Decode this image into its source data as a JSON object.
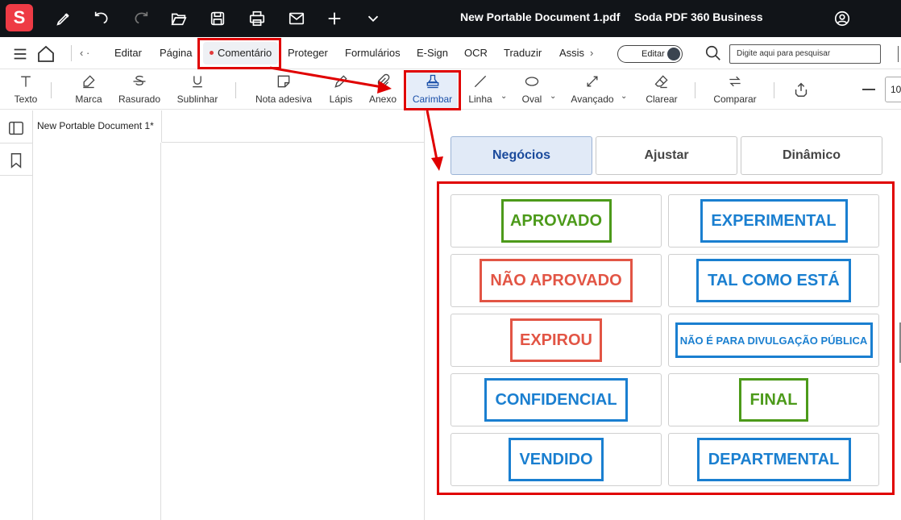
{
  "app": {
    "logo_letter": "S",
    "document_title": "New Portable Document 1.pdf",
    "app_title": "Soda PDF 360 Business"
  },
  "menu": {
    "back_label": "‹ ·",
    "items": [
      "Editar",
      "Página",
      "Comentário",
      "Proteger",
      "Formulários",
      "E-Sign",
      "OCR",
      "Traduzir",
      "Assis"
    ],
    "active": "Comentário",
    "more_label": "›",
    "edit_toggle_label": "Editar",
    "search_placeholder": "Digite aqui para pesquisar"
  },
  "toolbar": {
    "tools": [
      "Texto",
      "Marca",
      "Rasurado",
      "Sublinhar",
      "Nota adesiva",
      "Lápis",
      "Anexo",
      "Carimbar",
      "Linha",
      "Oval",
      "Avançado",
      "Clarear",
      "Comparar"
    ],
    "active": "Carimbar",
    "zoom_partial": "10"
  },
  "document": {
    "tab_label": "New Portable Document 1*"
  },
  "stamp_panel": {
    "tabs": [
      "Negócios",
      "Ajustar",
      "Dinâmico"
    ],
    "selected_tab": "Negócios",
    "stamps": [
      {
        "label": "APROVADO",
        "color": "#4c9a1a"
      },
      {
        "label": "EXPERIMENTAL",
        "color": "#1a7fd0"
      },
      {
        "label": "NÃO APROVADO",
        "color": "#e25545"
      },
      {
        "label": "TAL COMO ESTÁ",
        "color": "#1a7fd0"
      },
      {
        "label": "EXPIROU",
        "color": "#e25545"
      },
      {
        "label": "NÃO É PARA DIVULGAÇÃO PÚBLICA",
        "color": "#1a7fd0"
      },
      {
        "label": "CONFIDENCIAL",
        "color": "#1a7fd0"
      },
      {
        "label": "FINAL",
        "color": "#4c9a1a"
      },
      {
        "label": "VENDIDO",
        "color": "#1a7fd0"
      },
      {
        "label": "DEPARTMENTAL",
        "color": "#1a7fd0"
      }
    ]
  },
  "colors": {
    "titlebar_bg": "#111418",
    "logo_red": "#ee3b45",
    "annotation_red": "#e00000",
    "accent_blue": "#1a4fa8"
  },
  "icons": [
    "pen-icon",
    "undo-icon",
    "redo-icon",
    "folder-open-icon",
    "save-icon",
    "print-icon",
    "mail-icon",
    "plus-icon",
    "chevron-down-icon",
    "user-account-icon",
    "hamburger-menu-icon",
    "home-icon",
    "search-icon",
    "panel-toggle-icon",
    "bookmark-icon"
  ]
}
